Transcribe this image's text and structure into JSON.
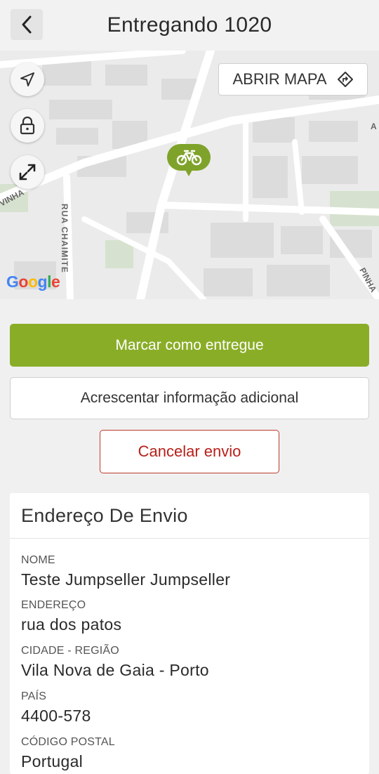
{
  "header": {
    "title": "Entregando 1020",
    "back_icon": "chevron-left-icon"
  },
  "map": {
    "open_map_label": "ABRIR MAPA",
    "open_map_icon": "directions-icon",
    "controls": [
      "navigation-arrow-icon",
      "lock-icon",
      "expand-icon"
    ],
    "marker_icon": "bicycle-icon",
    "marker_color": "#7fa32a",
    "street_labels": [
      "RUA CHAIMITE",
      "VINHA",
      "PINHA",
      "A"
    ],
    "attribution": "Google"
  },
  "actions": {
    "mark_delivered": "Marcar como entregue",
    "add_info": "Acrescentar informação adicional",
    "cancel": "Cancelar envio",
    "primary_color": "#8aad27",
    "danger_color": "#b7201a"
  },
  "shipping": {
    "title": "Endereço De Envio",
    "fields": [
      {
        "label": "NOME",
        "value": "Teste Jumpseller Jumpseller"
      },
      {
        "label": "ENDEREÇO",
        "value": "rua dos patos"
      },
      {
        "label": "CIDADE - REGIÃO",
        "value": "Vila Nova de Gaia - Porto"
      },
      {
        "label": "PAÍS",
        "value": "4400-578"
      },
      {
        "label": "CÓDIGO POSTAL",
        "value": "Portugal"
      }
    ]
  }
}
